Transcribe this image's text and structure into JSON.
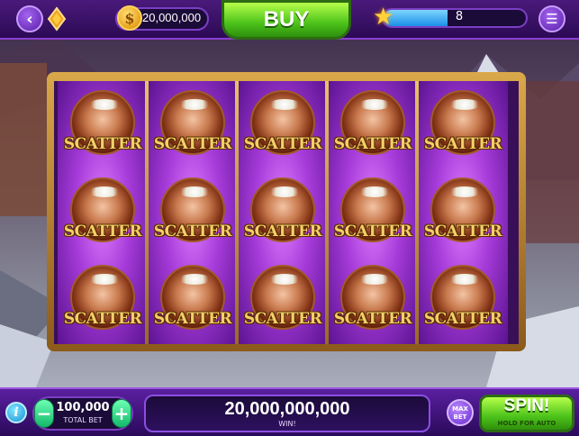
{
  "header": {
    "back_icon": "chevron-left-icon",
    "gem_icon": "flame-gem-icon",
    "coin_symbol": "$",
    "coin_balance": "20,000,000",
    "buy_label": "BUY",
    "level": "8",
    "level_progress": 0.45,
    "menu_icon": "hamburger-menu-icon"
  },
  "reels": {
    "symbol_label": "SCATTER",
    "columns": 5,
    "rows": 3
  },
  "footer": {
    "info_label": "i",
    "minus_label": "−",
    "plus_label": "+",
    "bet_value": "100,000",
    "bet_label": "TOTAL BET",
    "win_value": "20,000,000,000",
    "win_label": "WIN!",
    "max_bet_label_1": "MAX",
    "max_bet_label_2": "BET",
    "spin_label": "SPIN!",
    "spin_sublabel": "HOLD FOR AUTO"
  },
  "colors": {
    "accent_purple": "#5a1fa0",
    "buy_green": "#4cc21a",
    "gold": "#f2d06a"
  }
}
